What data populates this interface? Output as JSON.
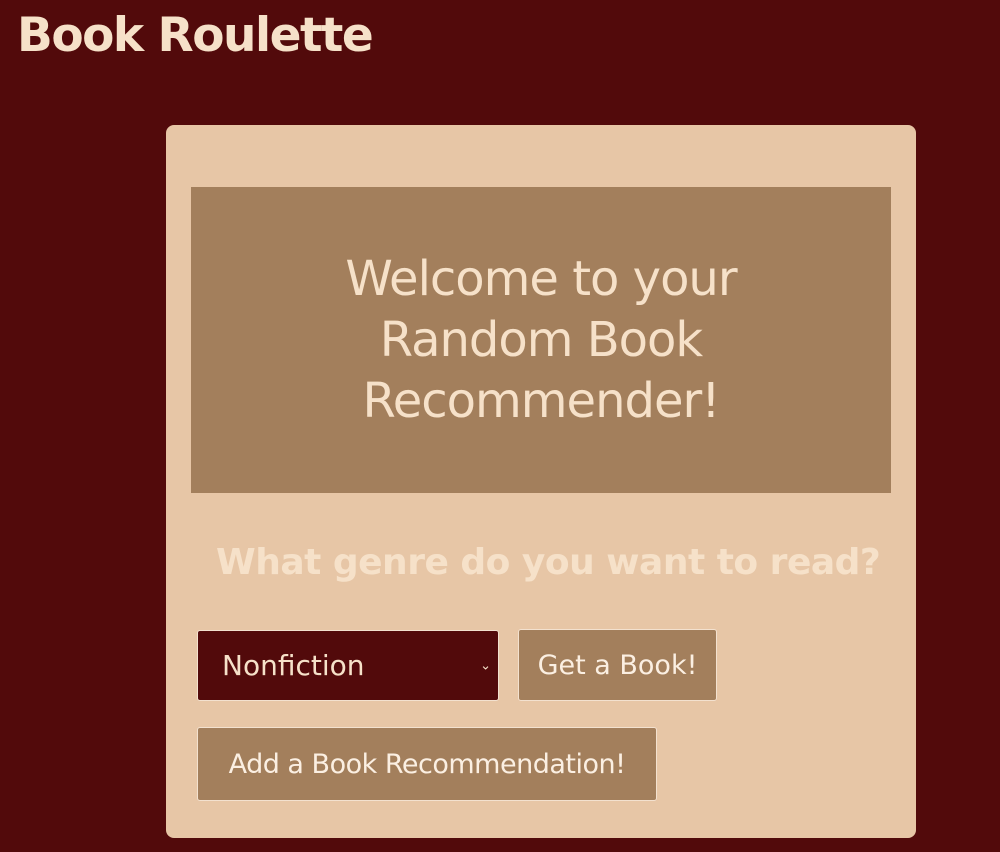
{
  "header": {
    "title": "Book Roulette"
  },
  "welcome": {
    "heading": "Welcome to your Random Book Recommender!"
  },
  "genre": {
    "prompt": "What genre do you want to read?",
    "selected": "Nonfiction",
    "chevron": "⌄"
  },
  "actions": {
    "get_book_label": "Get a Book!",
    "add_recommendation_label": "Add a Book Recommendation!"
  },
  "colors": {
    "background": "#520a0b",
    "card": "#e7c6a6",
    "banner": "#a37f5c",
    "text": "#f6e1c9"
  }
}
